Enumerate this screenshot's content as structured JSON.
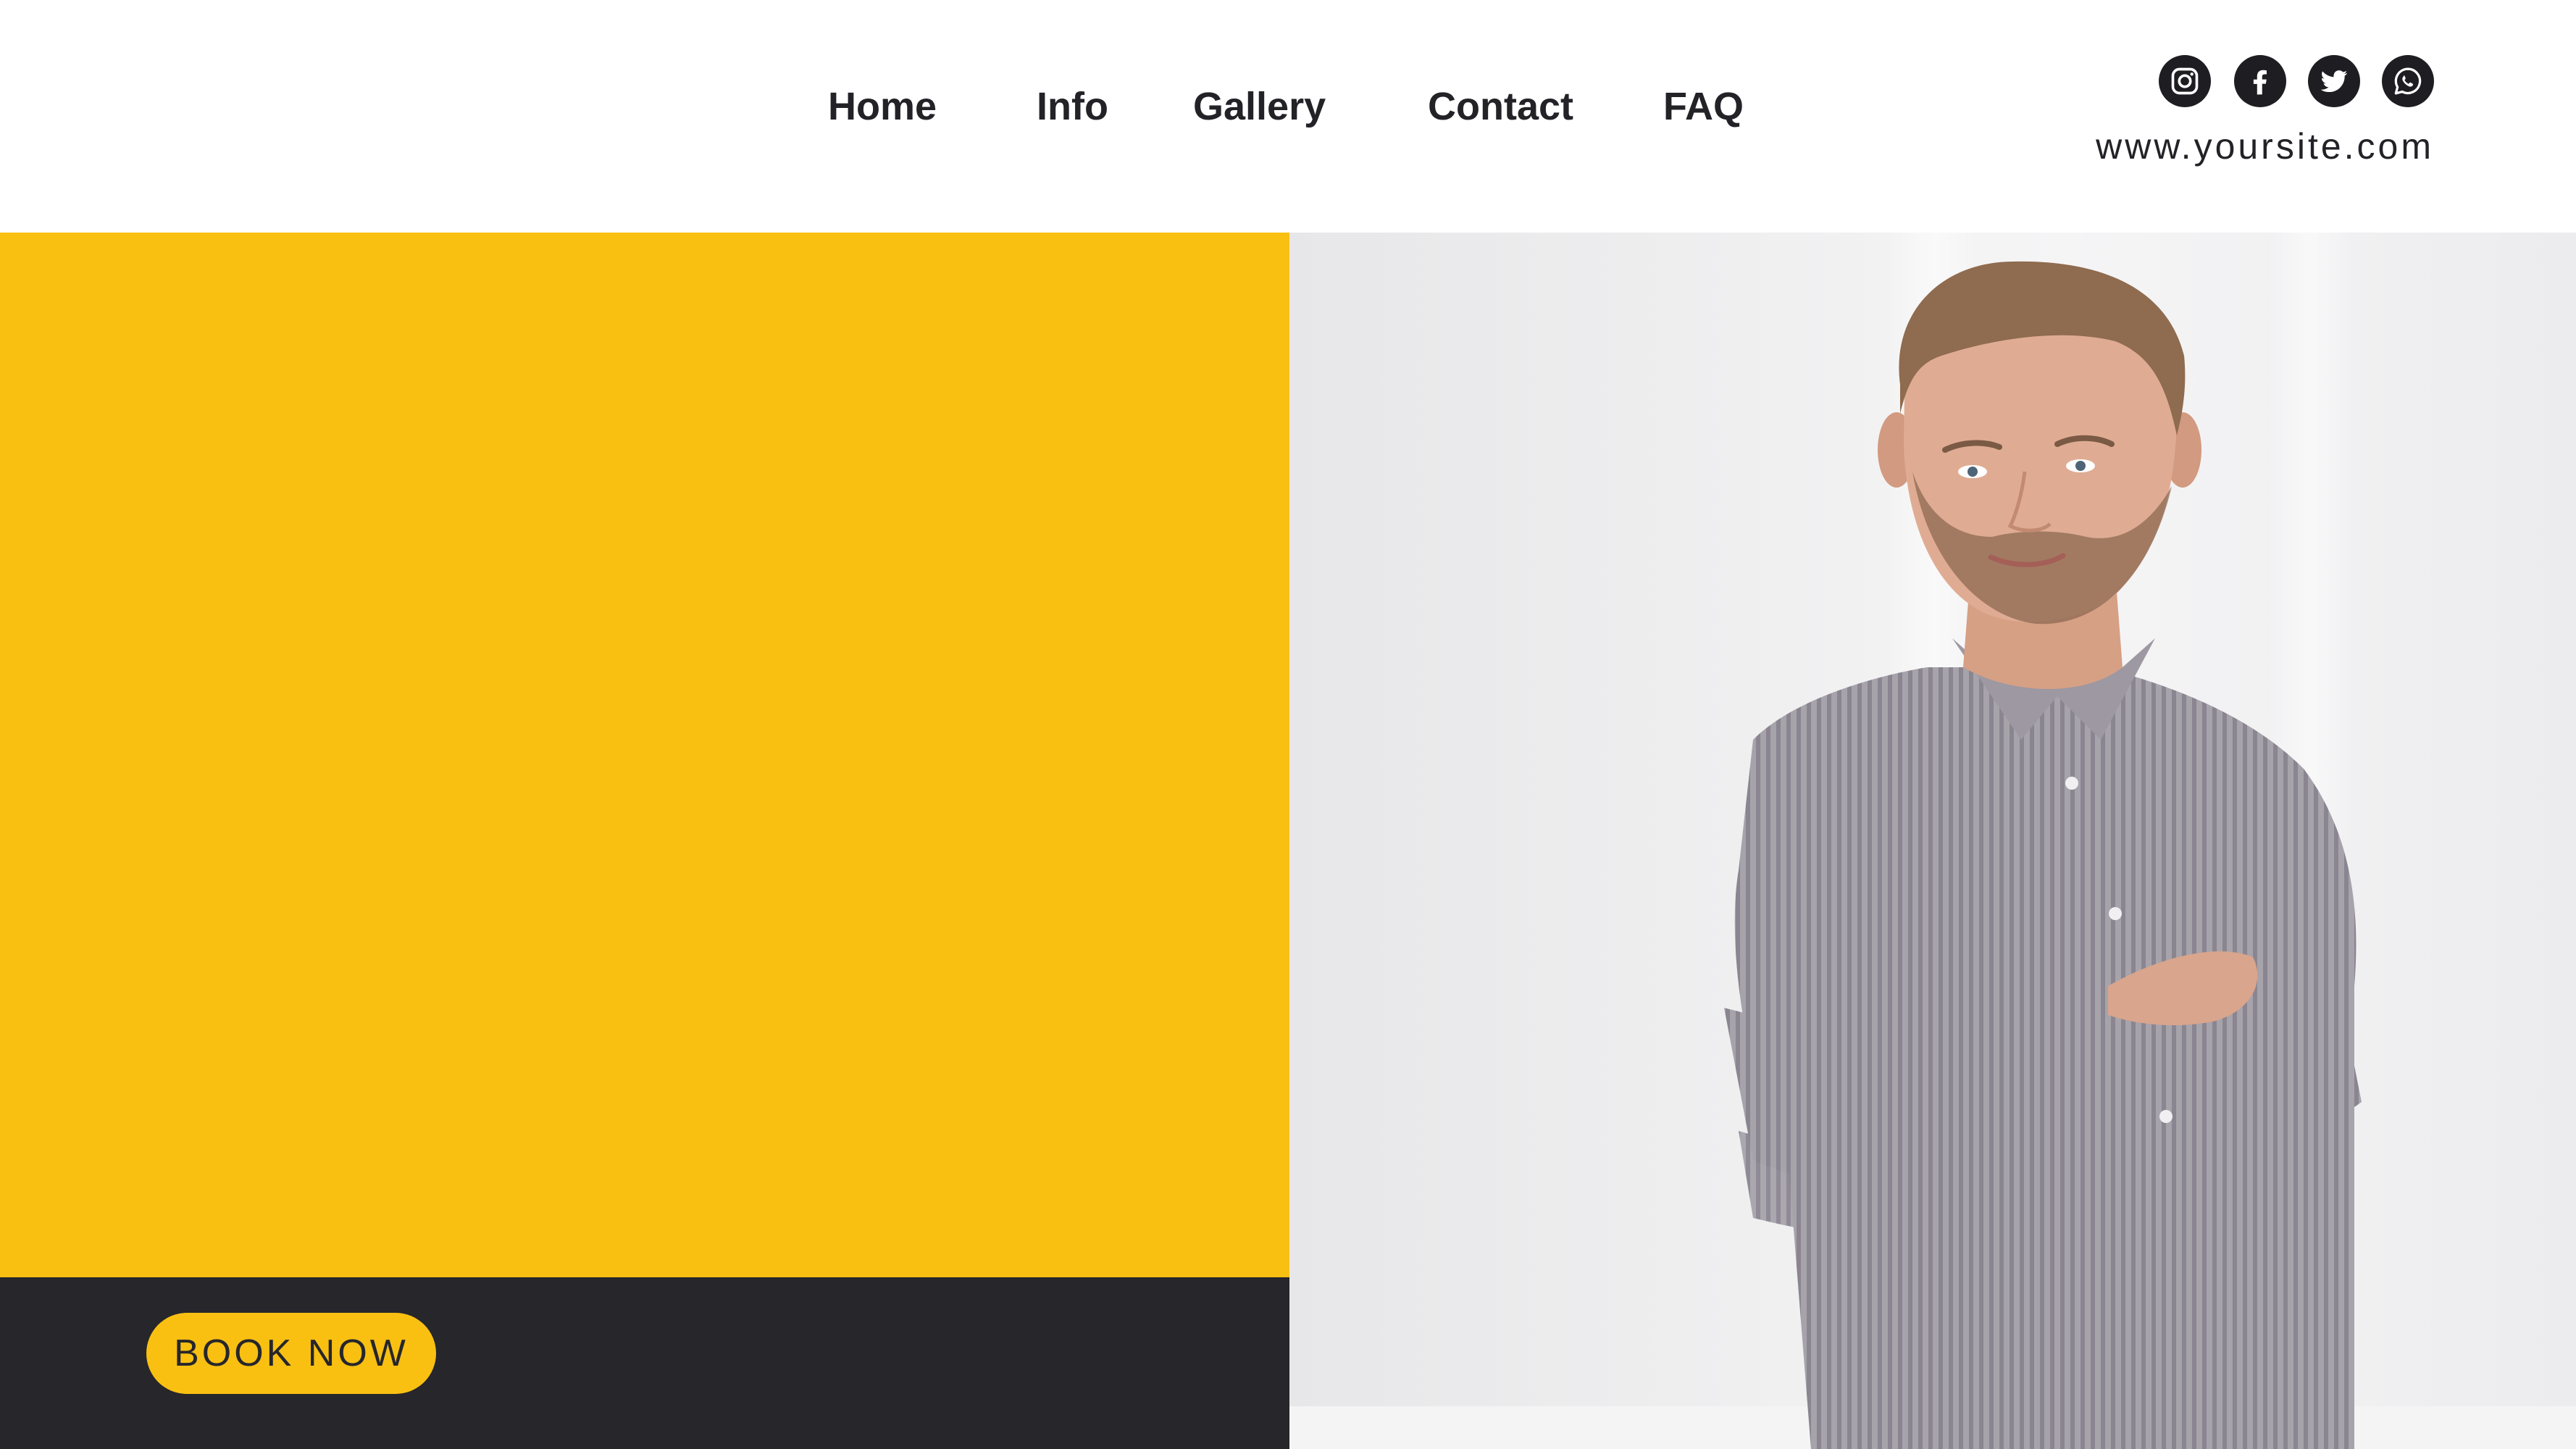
{
  "nav": {
    "items": [
      {
        "label": "Home"
      },
      {
        "label": "Info"
      },
      {
        "label": "Gallery"
      },
      {
        "label": "Contact"
      },
      {
        "label": "FAQ"
      }
    ]
  },
  "social": {
    "icons": [
      "instagram-icon",
      "facebook-icon",
      "twitter-icon",
      "whatsapp-icon"
    ]
  },
  "website": "www.yoursite.com",
  "hero": {
    "cta_label": "BOOK NOW"
  },
  "colors": {
    "accent": "#f9c012",
    "dark": "#26262b",
    "text": "#222227",
    "background": "#ffffff"
  }
}
